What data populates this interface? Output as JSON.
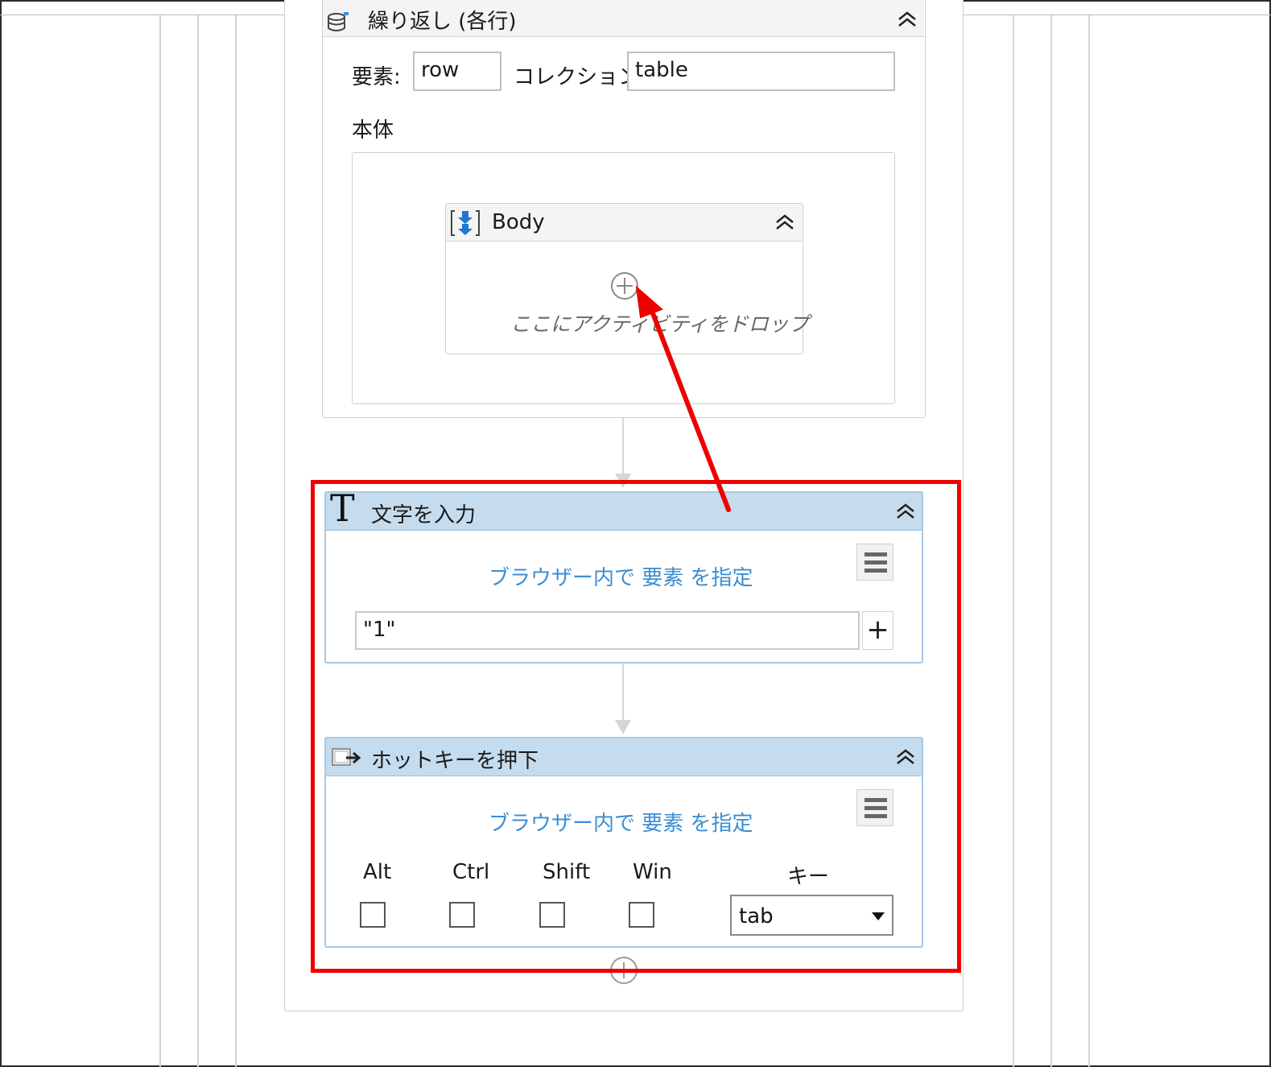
{
  "loop": {
    "title": "繰り返し (各行)",
    "element_label": "要素:",
    "element_value": "row",
    "collection_label": "コレクション:",
    "collection_value": "table",
    "body_label": "本体"
  },
  "body_sequence": {
    "title": "Body",
    "drop_hint": "ここにアクティビティをドロップ"
  },
  "type_into": {
    "title": "文字を入力",
    "target_link": "ブラウザー内で 要素 を指定",
    "text_value": "\"1\"",
    "add_button": "+"
  },
  "send_hotkey": {
    "title": "ホットキーを押下",
    "target_link": "ブラウザー内で 要素 を指定",
    "modifiers": [
      "Alt",
      "Ctrl",
      "Shift",
      "Win"
    ],
    "key_label": "キー",
    "key_value": "tab"
  },
  "colors": {
    "highlight": "#ee0000",
    "header_blue": "#c5dcee",
    "link_blue": "#3b8ed3"
  }
}
